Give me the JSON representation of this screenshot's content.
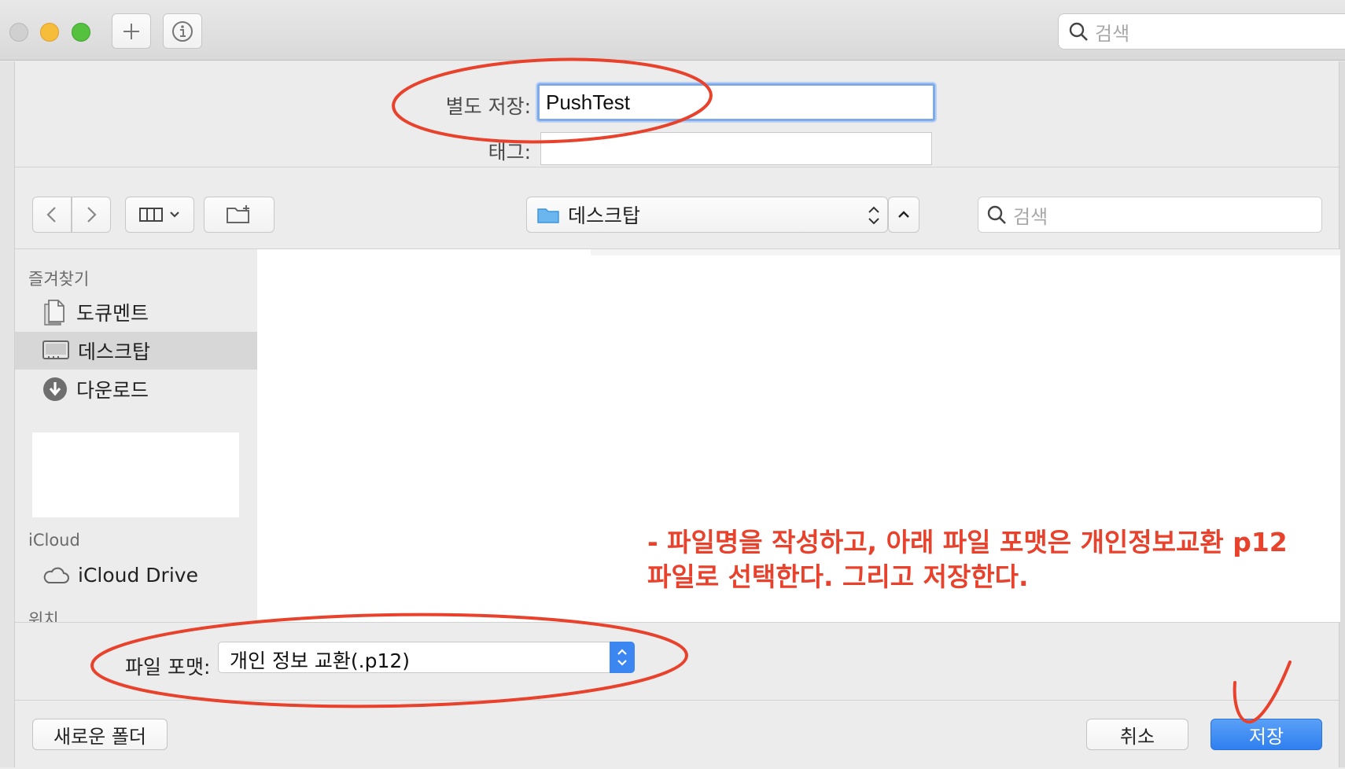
{
  "window": {
    "top_search_placeholder": "검색"
  },
  "dialog": {
    "save_as_label": "별도 저장:",
    "save_as_value": "PushTest",
    "tags_label": "태그:",
    "location": "데스크탑",
    "search_placeholder": "검색"
  },
  "sidebar": {
    "favorites_header": "즐겨찾기",
    "favorites": [
      {
        "label": "도큐멘트",
        "icon": "document-icon"
      },
      {
        "label": "데스크탑",
        "icon": "desktop-icon",
        "selected": true
      },
      {
        "label": "다운로드",
        "icon": "download-icon"
      }
    ],
    "icloud_header": "iCloud",
    "icloud_items": [
      {
        "label": "iCloud Drive",
        "icon": "cloud-icon"
      }
    ],
    "locations_header": "위치"
  },
  "annotation": {
    "line1": "- 파일명을 작성하고, 아래 파일 포맷은 개인정보교환 p12",
    "line2": "파일로 선택한다. 그리고 저장한다."
  },
  "format": {
    "label": "파일 포맷:",
    "selected": "개인 정보 교환(.p12)"
  },
  "buttons": {
    "new_folder": "새로운 폴더",
    "cancel": "취소",
    "save": "저장"
  },
  "colors": {
    "accent": "#3c86f2",
    "annotation_red": "#e8412c"
  }
}
